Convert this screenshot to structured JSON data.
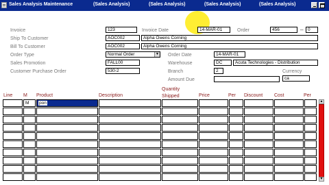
{
  "window": {
    "title": "Sales Analysis Maintenance",
    "title_repeats": [
      "(Sales Analysis)",
      "(Sales Analysis)",
      "(Sales Analysis)",
      "(Sales Analysis)"
    ],
    "titlebar_color": "#0a2a8f"
  },
  "header": {
    "invoice": {
      "label": "Invoice",
      "value": "123"
    },
    "invoice_date": {
      "label": "Invoice Date",
      "value": "14-MAR-01"
    },
    "order": {
      "label": "Order",
      "value": "456",
      "dash": "--",
      "seq": "0"
    },
    "ship_to": {
      "label": "Ship To Customer",
      "code": "AOC002",
      "name": "Alpha Owens Corning"
    },
    "bill_to": {
      "label": "Bill To Customer",
      "code": "AOC002",
      "name": "Alpha Owens Corning"
    },
    "order_type": {
      "label": "Order Type",
      "value": "Normal Order"
    },
    "order_date": {
      "label": "Order Date",
      "value": "14-MAR-01"
    },
    "sales_promotion": {
      "label": "Sales Promotion",
      "value": "FALL00"
    },
    "warehouse": {
      "label": "Warehouse",
      "code": "DC",
      "name": "Acuta Technologies - Distribution"
    },
    "customer_po": {
      "label": "Customer Purchase Order",
      "value": "530-2"
    },
    "branch": {
      "label": "Branch",
      "value": "2"
    },
    "currency": {
      "label": "Currency",
      "value": "ca"
    },
    "amount_due": {
      "label": "Amount Due",
      "value": ""
    }
  },
  "lines": {
    "columns": {
      "line": "Line",
      "m": "M",
      "product": "Product",
      "description": "Description",
      "quantity_shipped": [
        "Quantity",
        "Shipped"
      ],
      "price": "Price",
      "per1": "Per",
      "discount": "Discount",
      "cost": "Cost",
      "per2": "Per"
    },
    "rows": [
      {
        "line": "",
        "m": "M",
        "product": "pon",
        "active": true
      },
      {
        "line": "",
        "m": "",
        "product": ""
      },
      {
        "line": "",
        "m": "",
        "product": ""
      },
      {
        "line": "",
        "m": "",
        "product": ""
      },
      {
        "line": "",
        "m": "",
        "product": ""
      },
      {
        "line": "",
        "m": "",
        "product": ""
      },
      {
        "line": "",
        "m": "",
        "product": ""
      },
      {
        "line": "",
        "m": "",
        "product": ""
      },
      {
        "line": "",
        "m": "",
        "product": ""
      },
      {
        "line": "",
        "m": "",
        "product": ""
      }
    ]
  },
  "scrollbar": {
    "thumb_color": "#e01010"
  }
}
